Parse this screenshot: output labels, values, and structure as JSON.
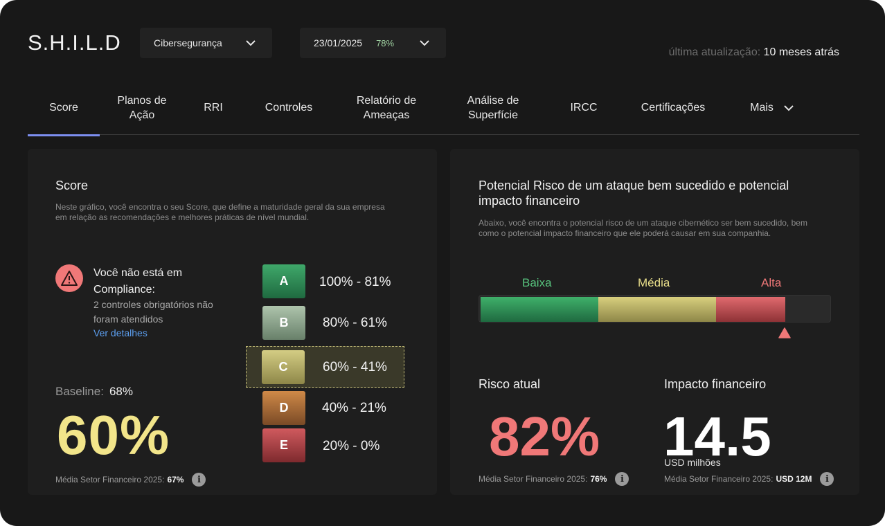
{
  "app": {
    "logo": "S.H.I.L.D"
  },
  "filters": {
    "category": "Cibersegurança",
    "date": "23/01/2025",
    "date_pct": "78%"
  },
  "updated": {
    "label": "última atualização:",
    "value": "10 meses atrás"
  },
  "tabs": [
    {
      "label": "Score",
      "active": true
    },
    {
      "label": "Planos de Ação"
    },
    {
      "label": "RRI"
    },
    {
      "label": "Controles"
    },
    {
      "label": "Relatório de Ameaças"
    },
    {
      "label": "Análise de Superfície"
    },
    {
      "label": "IRCC"
    },
    {
      "label": "Certificações"
    },
    {
      "label": "Mais"
    }
  ],
  "score_card": {
    "title": "Score",
    "description": "Neste gráfico, você encontra o seu Score, que define a maturidade geral da sua empresa em relação as recomendações e melhores práticas de nível mundial.",
    "compliance": {
      "title": "Você não está em Compliance:",
      "subtitle": "2 controles obrigatórios não foram atendidos",
      "link": "Ver detalhes"
    },
    "grades": [
      {
        "letter": "A",
        "range": "100% - 81%",
        "color": "#2e8a55"
      },
      {
        "letter": "B",
        "range": "80% - 61%",
        "color": "#8fa88f"
      },
      {
        "letter": "C",
        "range": "60% - 41%",
        "color": "#c4bd6e",
        "selected": true
      },
      {
        "letter": "D",
        "range": "40% - 21%",
        "color": "#c07a3c"
      },
      {
        "letter": "E",
        "range": "20% - 0%",
        "color": "#c4484c"
      }
    ],
    "baseline_label": "Baseline:",
    "baseline_value": "68%",
    "score": "60%",
    "sector_avg_label": "Média Setor Financeiro 2025:",
    "sector_avg_value": "67%"
  },
  "risk_card": {
    "title": "Potencial Risco de um ataque bem sucedido e potencial impacto financeiro",
    "description": "Abaixo, você encontra o potencial risco de um ataque cibernético ser bem sucedido, bem como o potencial impacto financeiro que ele poderá causar em sua companhia.",
    "levels": [
      {
        "label": "Baixa",
        "color": "#58c47e"
      },
      {
        "label": "Média",
        "color": "#e8de8a"
      },
      {
        "label": "Alta",
        "color": "#f07878"
      }
    ],
    "risk_level_fraction": 0.82,
    "current_risk": {
      "title": "Risco atual",
      "value": "82%",
      "avg_label": "Média Setor Financeiro 2025:",
      "avg_value": "76%"
    },
    "financial_impact": {
      "title": "Impacto financeiro",
      "value": "14.5",
      "unit": "USD milhões",
      "avg_label": "Média Setor Financeiro 2025:",
      "avg_value": "USD 12M"
    }
  },
  "colors": {
    "accent_tab": "#7d8ff0",
    "score": "#f2e58a",
    "risk": "#f07878",
    "link": "#5c9ff0"
  }
}
